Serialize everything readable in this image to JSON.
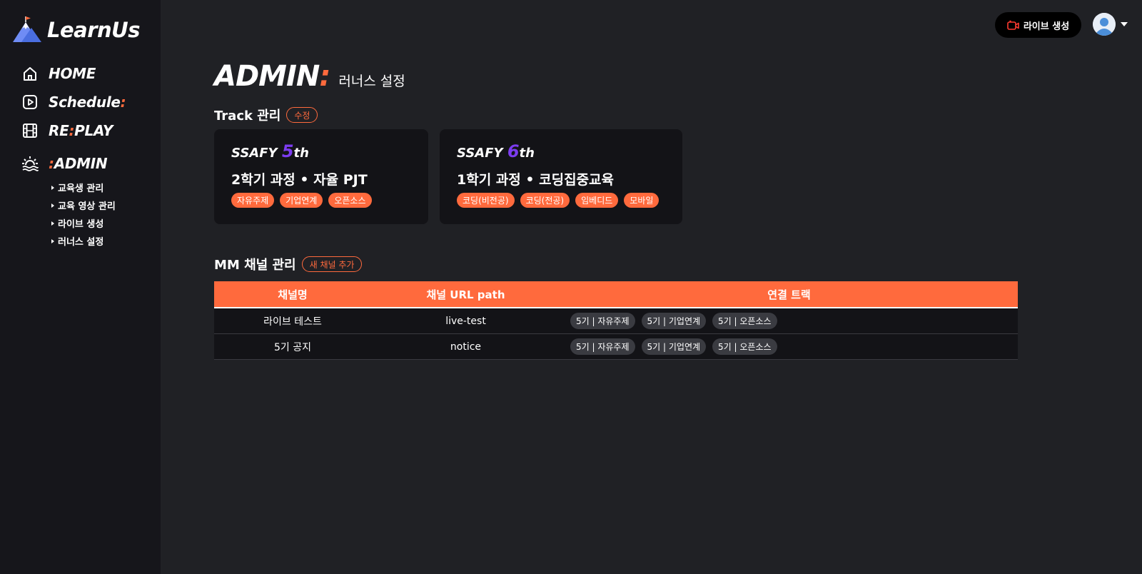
{
  "brand": {
    "name": "LearnUs"
  },
  "nav": {
    "home": "HOME",
    "schedule": "Schedule",
    "schedule_suffix": ":",
    "replay_a": "RE",
    "replay_colon": ":",
    "replay_b": "PLAY",
    "admin_prefix": ":",
    "admin": "ADMIN",
    "sub_items": [
      "교육생 관리",
      "교육 영상 관리",
      "라이브 생성",
      "러너스 설정"
    ]
  },
  "topbar": {
    "live_button": "라이브 생성"
  },
  "page": {
    "title": "ADMIN",
    "title_suffix": ":",
    "subtitle": "러너스 설정"
  },
  "track_section": {
    "title": "Track 관리",
    "edit_button": "수정"
  },
  "tracks": [
    {
      "brand": "SSAFY",
      "gen_num": "5",
      "gen_suffix": "th",
      "course": "2학기 과정 • 자율 PJT",
      "tags": [
        "자유주제",
        "기업연계",
        "오픈소스"
      ]
    },
    {
      "brand": "SSAFY",
      "gen_num": "6",
      "gen_suffix": "th",
      "course": "1학기 과정 • 코딩집중교육",
      "tags": [
        "코딩(비전공)",
        "코딩(전공)",
        "임베디드",
        "모바일"
      ]
    }
  ],
  "channel_section": {
    "title": "MM 채널 관리",
    "add_button": "새 채널 추가"
  },
  "table": {
    "headers": [
      "채널명",
      "채널 URL path",
      "연결 트랙"
    ],
    "rows": [
      {
        "name": "라이브 테스트",
        "path": "live-test",
        "tracks": [
          "5기 | 자유주제",
          "5기 | 기업연계",
          "5기 | 오픈소스"
        ]
      },
      {
        "name": "5기 공지",
        "path": "notice",
        "tracks": [
          "5기 | 자유주제",
          "5기 | 기업연계",
          "5기 | 오픈소스"
        ]
      }
    ]
  },
  "colors": {
    "accent": "#ff6a3d",
    "purple": "#7c3cf0",
    "bg": "#202125",
    "sidebar": "#16161b",
    "card": "#131317"
  }
}
